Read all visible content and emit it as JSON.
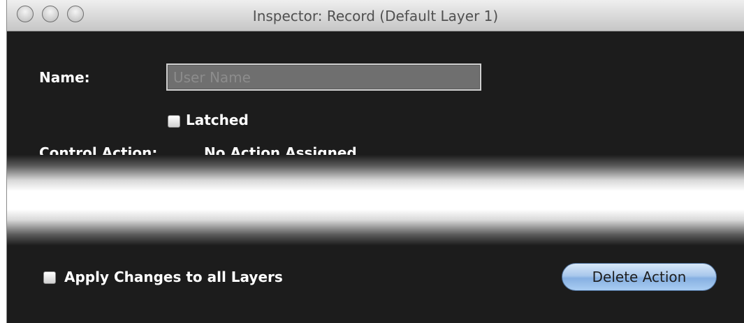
{
  "window": {
    "title": "Inspector: Record (Default Layer 1)"
  },
  "form": {
    "name_label": "Name:",
    "name_input": {
      "value": "",
      "placeholder": "User Name"
    },
    "latched_label": "Latched",
    "latched_checked": false,
    "control_action_label": "Control Action:",
    "control_action_value": "No Action Assigned"
  },
  "footer": {
    "apply_all_label": "Apply Changes to all Layers",
    "apply_all_checked": false,
    "delete_button_label": "Delete Action"
  },
  "colors": {
    "panel_background": "#1c1c1c",
    "button_accent": "#86b0e2"
  }
}
